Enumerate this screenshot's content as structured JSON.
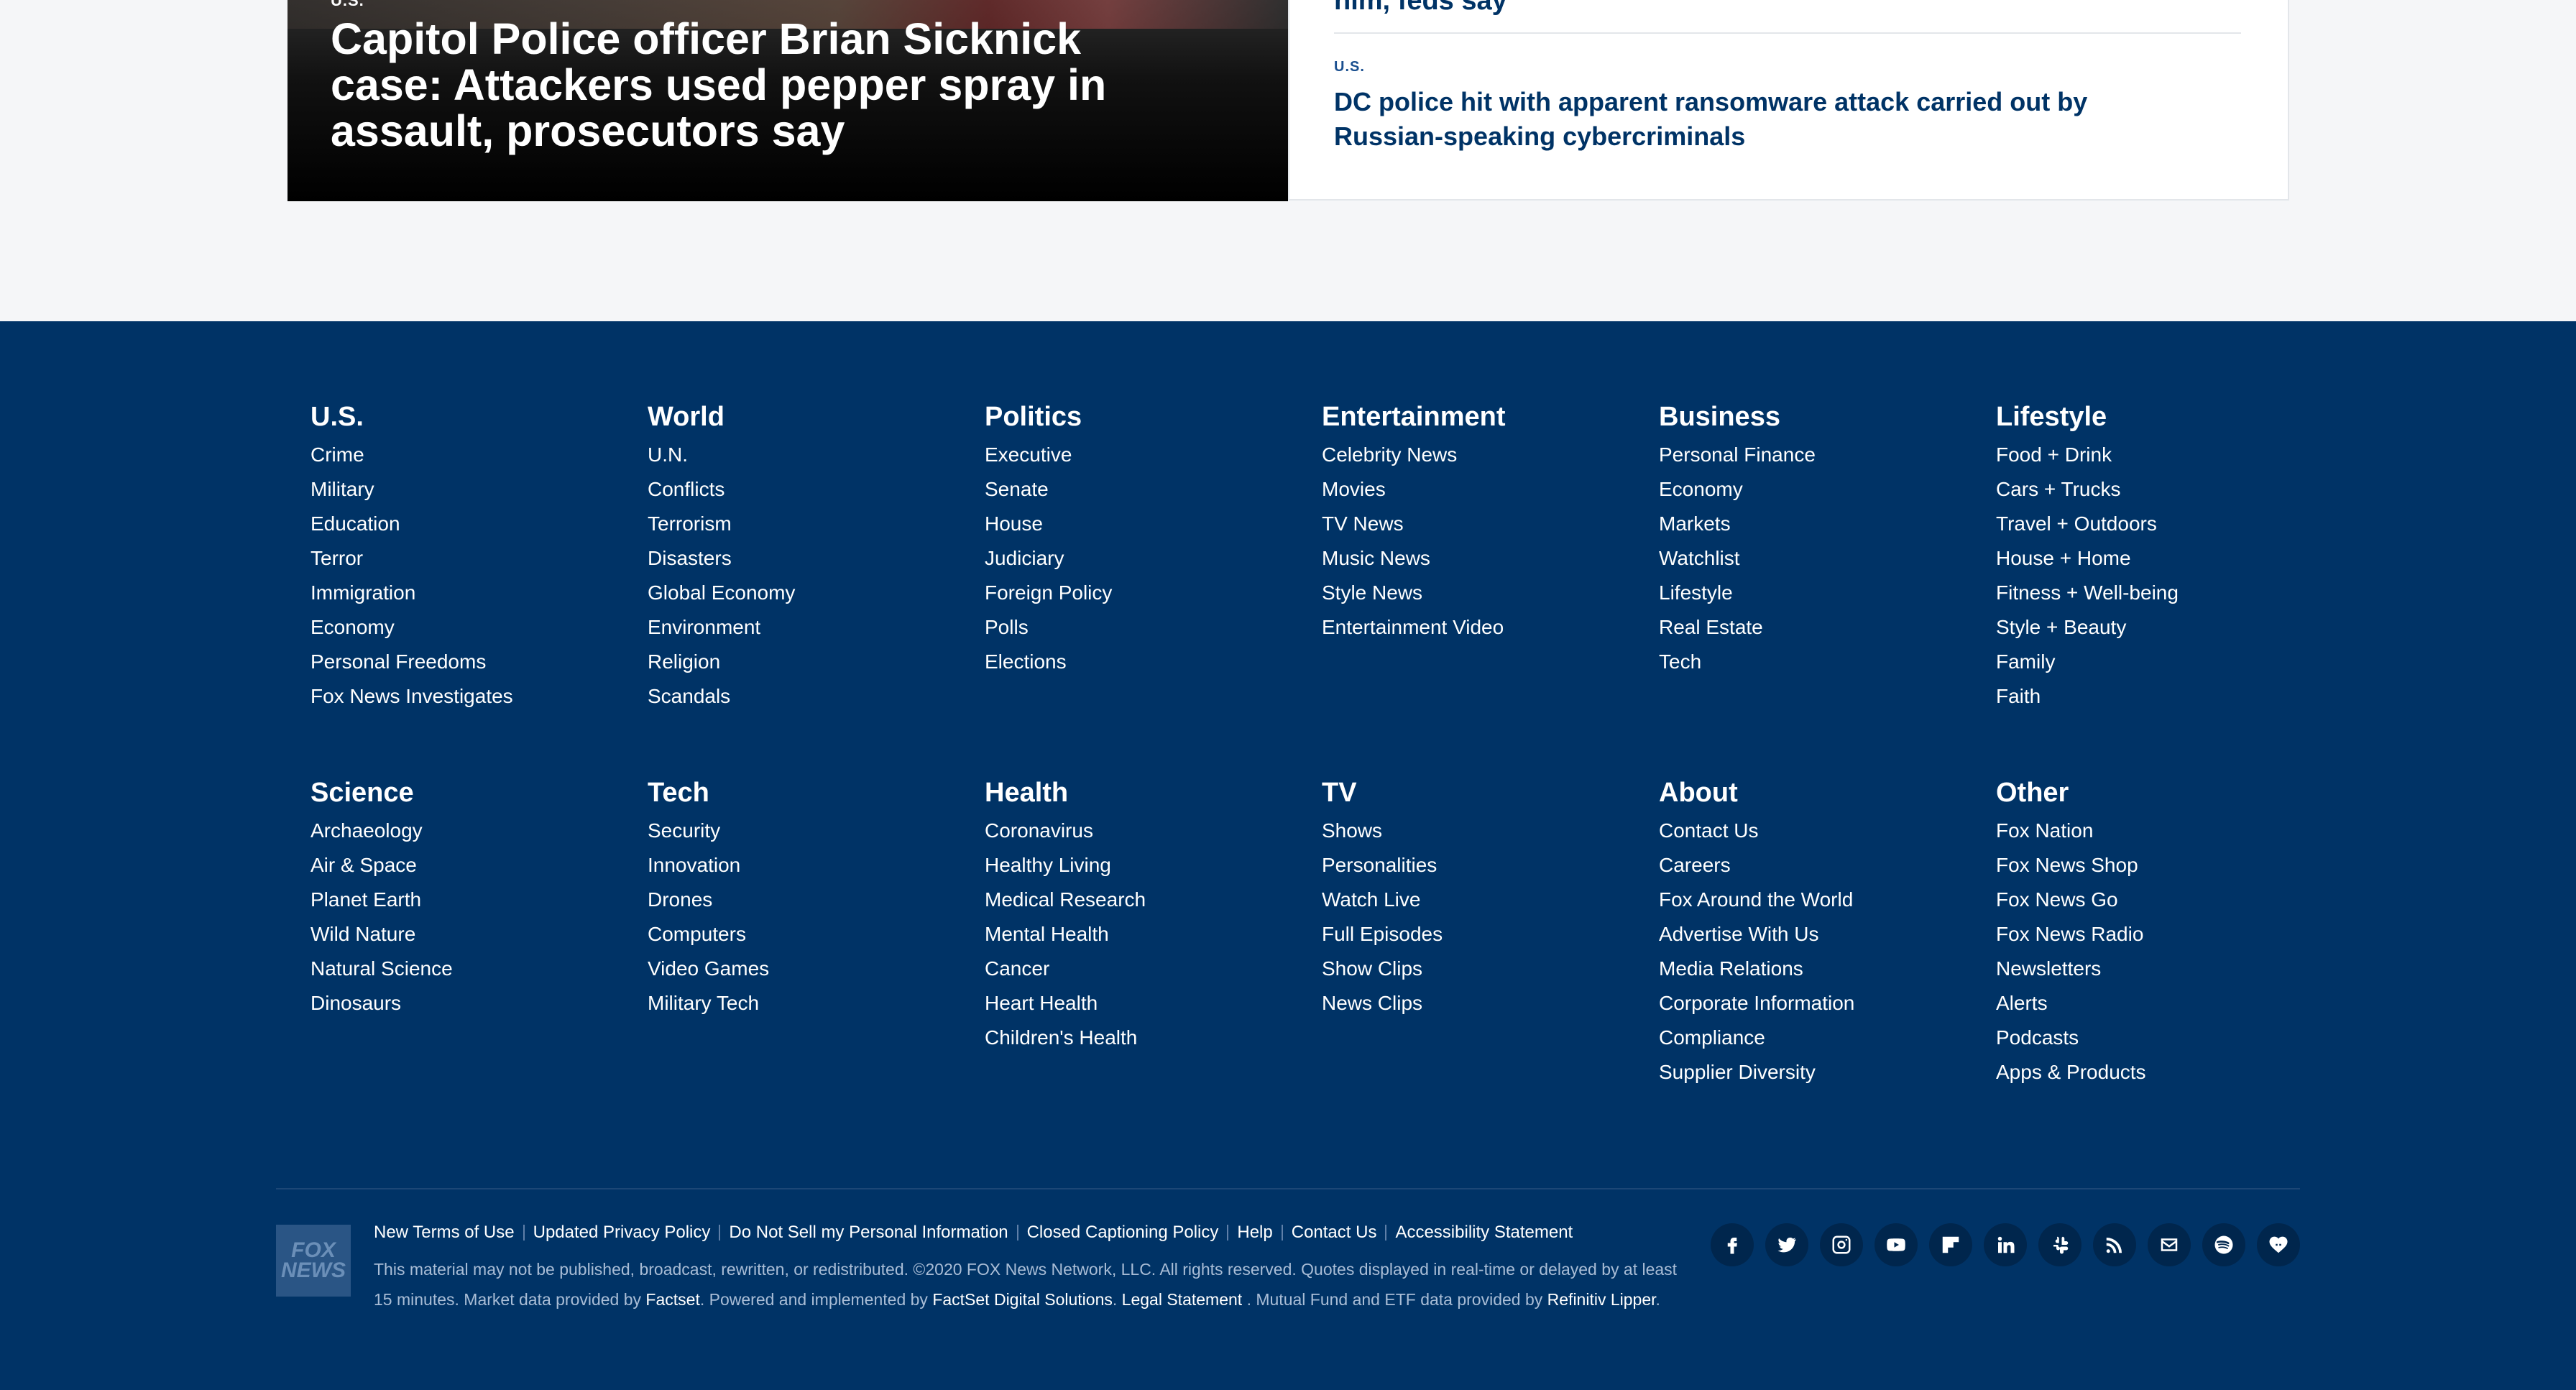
{
  "hero": {
    "category": "U.S.",
    "title": "Capitol Police officer Brian Sicknick case: Attackers used pepper spray in assault, prosecutors say"
  },
  "sidebar": {
    "previous_title_tail": "him, feds say",
    "category": "U.S.",
    "title": "DC police hit with apparent ransomware attack carried out by Russian-speaking cybercriminals"
  },
  "footer": {
    "columns_row1": [
      {
        "heading": "U.S.",
        "items": [
          "Crime",
          "Military",
          "Education",
          "Terror",
          "Immigration",
          "Economy",
          "Personal Freedoms",
          "Fox News Investigates"
        ]
      },
      {
        "heading": "World",
        "items": [
          "U.N.",
          "Conflicts",
          "Terrorism",
          "Disasters",
          "Global Economy",
          "Environment",
          "Religion",
          "Scandals"
        ]
      },
      {
        "heading": "Politics",
        "items": [
          "Executive",
          "Senate",
          "House",
          "Judiciary",
          "Foreign Policy",
          "Polls",
          "Elections"
        ]
      },
      {
        "heading": "Entertainment",
        "items": [
          "Celebrity News",
          "Movies",
          "TV News",
          "Music News",
          "Style News",
          "Entertainment Video"
        ]
      },
      {
        "heading": "Business",
        "items": [
          "Personal Finance",
          "Economy",
          "Markets",
          "Watchlist",
          "Lifestyle",
          "Real Estate",
          "Tech"
        ]
      },
      {
        "heading": "Lifestyle",
        "items": [
          "Food + Drink",
          "Cars + Trucks",
          "Travel + Outdoors",
          "House + Home",
          "Fitness + Well-being",
          "Style + Beauty",
          "Family",
          "Faith"
        ]
      }
    ],
    "columns_row2": [
      {
        "heading": "Science",
        "items": [
          "Archaeology",
          "Air & Space",
          "Planet Earth",
          "Wild Nature",
          "Natural Science",
          "Dinosaurs"
        ]
      },
      {
        "heading": "Tech",
        "items": [
          "Security",
          "Innovation",
          "Drones",
          "Computers",
          "Video Games",
          "Military Tech"
        ]
      },
      {
        "heading": "Health",
        "items": [
          "Coronavirus",
          "Healthy Living",
          "Medical Research",
          "Mental Health",
          "Cancer",
          "Heart Health",
          "Children's Health"
        ]
      },
      {
        "heading": "TV",
        "items": [
          "Shows",
          "Personalities",
          "Watch Live",
          "Full Episodes",
          "Show Clips",
          "News Clips"
        ]
      },
      {
        "heading": "About",
        "items": [
          "Contact Us",
          "Careers",
          "Fox Around the World",
          "Advertise With Us",
          "Media Relations",
          "Corporate Information",
          "Compliance",
          "Supplier Diversity"
        ]
      },
      {
        "heading": "Other",
        "items": [
          "Fox Nation",
          "Fox News Shop",
          "Fox News Go",
          "Fox News Radio",
          "Newsletters",
          "Alerts",
          "Podcasts",
          "Apps & Products"
        ]
      }
    ],
    "logo_text": [
      "FOX",
      "NEWS"
    ],
    "legal_links": [
      "New Terms of Use",
      "Updated Privacy Policy",
      "Do Not Sell my Personal Information",
      "Closed Captioning Policy",
      "Help",
      "Contact Us",
      "Accessibility Statement"
    ],
    "legal": {
      "part1": "This material may not be published, broadcast, rewritten, or redistributed. ©2020 FOX News Network, LLC. All rights reserved. Quotes displayed in real-time or delayed by at least 15 minutes. Market data provided by ",
      "factset": "Factset",
      "part2": ". Powered and implemented by ",
      "factset_solutions": "FactSet Digital Solutions",
      "part3": ". ",
      "legal_statement": "Legal Statement",
      "part4": " . Mutual Fund and ETF data provided by ",
      "refinitiv": "Refinitiv Lipper",
      "part5": "."
    },
    "socials": [
      "facebook-icon",
      "twitter-icon",
      "instagram-icon",
      "youtube-icon",
      "flipboard-icon",
      "linkedin-icon",
      "slack-icon",
      "rss-icon",
      "email-icon",
      "spotify-icon",
      "iheartradio-icon"
    ]
  }
}
